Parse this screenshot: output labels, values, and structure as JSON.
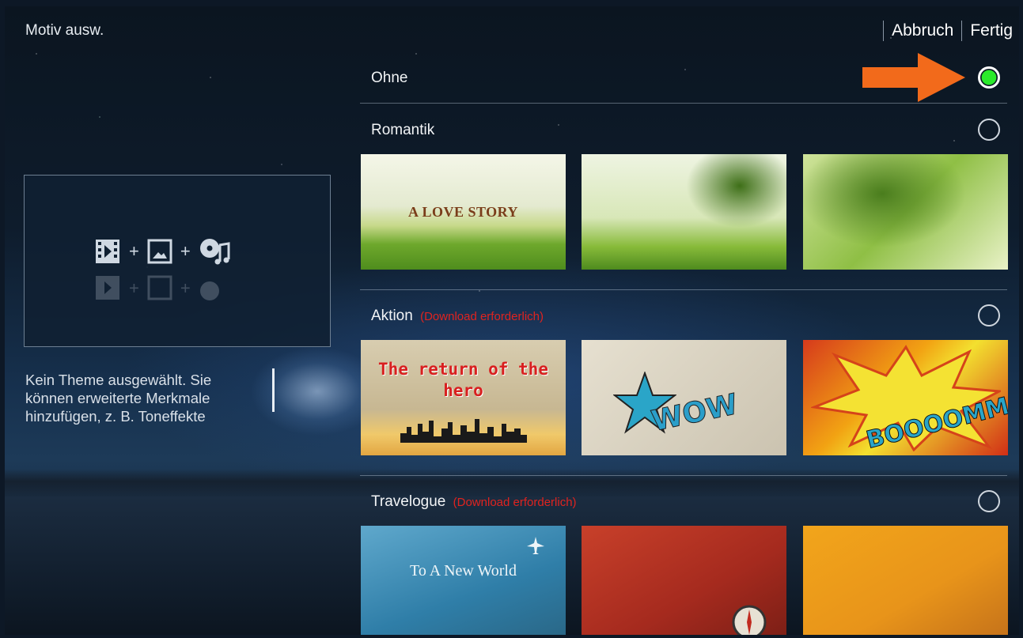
{
  "header": {
    "title": "Motiv ausw.",
    "cancel_label": "Abbruch",
    "done_label": "Fertig"
  },
  "preview": {
    "description": "Kein Theme ausgewählt. Sie können erweiterte Merkmale hinzufügen, z. B. Toneffekte",
    "icons": [
      "video-clip-icon",
      "image-icon",
      "music-icon"
    ]
  },
  "themes": [
    {
      "label": "Ohne",
      "selected": true,
      "download": ""
    },
    {
      "label": "Romantik",
      "selected": false,
      "download": "",
      "thumbnails": [
        "A LOVE STORY",
        "",
        ""
      ]
    },
    {
      "label": "Aktion",
      "selected": false,
      "download": "(Download erforderlich)",
      "thumbnails": [
        "The return of the hero",
        "WOW",
        "BOOOOMM"
      ]
    },
    {
      "label": "Travelogue",
      "selected": false,
      "download": "(Download erforderlich)",
      "thumbnails": [
        "To A New World",
        "",
        ""
      ]
    }
  ],
  "colors": {
    "selected_radio": "#2bea2b",
    "download_warning": "#e0231f",
    "arrow": "#f26a1b"
  }
}
